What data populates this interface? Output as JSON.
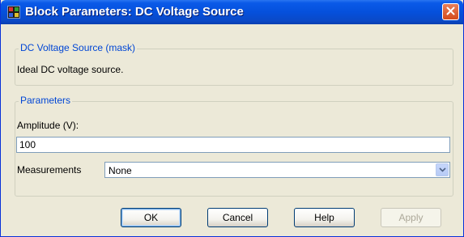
{
  "window": {
    "title": "Block Parameters: DC Voltage Source",
    "icon": "simulink-block-icon",
    "close_icon": "close-icon"
  },
  "description_group": {
    "legend": "DC Voltage Source (mask)",
    "text": "Ideal DC voltage source."
  },
  "parameters_group": {
    "legend": "Parameters",
    "amplitude_label": "Amplitude (V):",
    "amplitude_value": "100",
    "measurements_label": "Measurements",
    "measurements_selected": "None"
  },
  "buttons": {
    "ok": "OK",
    "cancel": "Cancel",
    "help": "Help",
    "apply": "Apply"
  },
  "colors": {
    "titlebar": "#0550dc",
    "dialog_background": "#ece9d8",
    "group_legend": "#0046d5",
    "close_button": "#d54b1b"
  }
}
